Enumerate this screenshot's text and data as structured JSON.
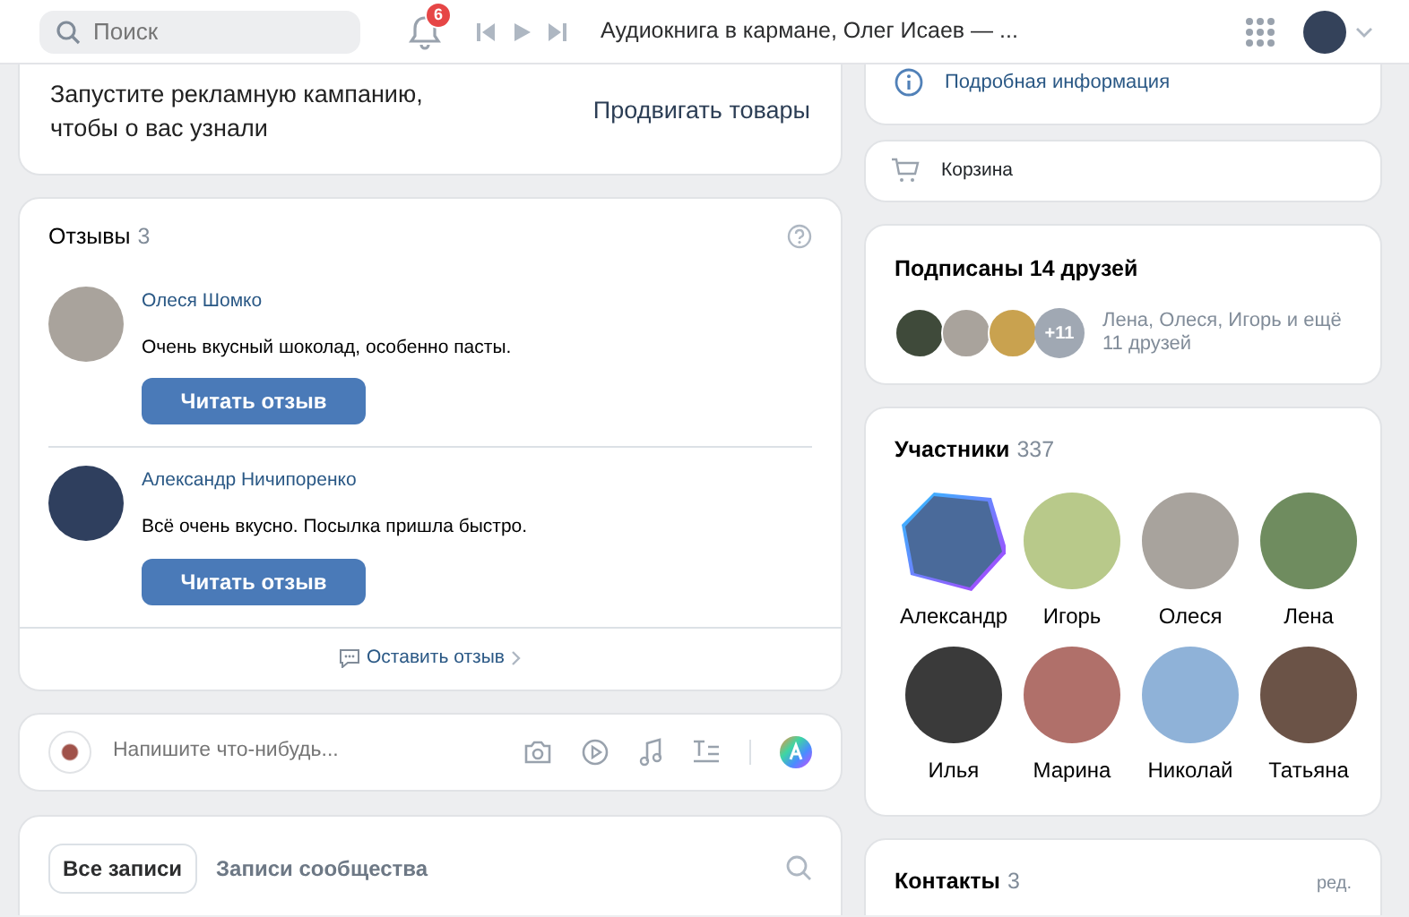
{
  "header": {
    "search": {
      "placeholder": "Поиск"
    },
    "notifications": {
      "count": "6"
    },
    "player": {
      "track": "Аудиокнига в кармане, Олег Исаев — ..."
    }
  },
  "promo": {
    "text": "Запустите рекламную кампанию, чтобы о вас узнали",
    "action": "Продвигать товары"
  },
  "reviews": {
    "title": "Отзывы",
    "count": "3",
    "items": [
      {
        "author": "Олеся Шомко",
        "text": "Очень вкусный шоколад, особенно пасты.",
        "button": "Читать отзыв"
      },
      {
        "author": "Александр Ничипоренко",
        "text": "Всё очень вкусно. Посылка пришла быстро.",
        "button": "Читать отзыв"
      }
    ],
    "footer": "Оставить отзыв"
  },
  "composer": {
    "placeholder": "Напишите что-нибудь..."
  },
  "wall": {
    "tabs": [
      {
        "label": "Все записи",
        "selected": true
      },
      {
        "label": "Записи сообщества",
        "selected": false
      }
    ]
  },
  "info": {
    "link": "Подробная информация"
  },
  "cart": {
    "label": "Корзина"
  },
  "friends": {
    "title": "Подписаны 14 друзей",
    "more": "+11",
    "text": "Лена, Олеся, Игорь и ещё 11 друзей"
  },
  "members": {
    "title": "Участники",
    "count": "337",
    "items": [
      {
        "name": "Александр",
        "kind": "story",
        "color": "#4a6a9a"
      },
      {
        "name": "Игорь",
        "kind": "plain",
        "color": "#b8c98a"
      },
      {
        "name": "Олеся",
        "kind": "plain",
        "color": "#a8a39d"
      },
      {
        "name": "Лена",
        "kind": "plain",
        "color": "#6f8c5f"
      },
      {
        "name": "Илья",
        "kind": "plain",
        "color": "#3a3a3a"
      },
      {
        "name": "Марина",
        "kind": "plain",
        "color": "#b0706a"
      },
      {
        "name": "Николай",
        "kind": "plain",
        "color": "#8fb2d8"
      },
      {
        "name": "Татьяна",
        "kind": "plain",
        "color": "#6b5347"
      }
    ]
  },
  "contacts": {
    "title": "Контакты",
    "count": "3",
    "edit": "ред."
  }
}
